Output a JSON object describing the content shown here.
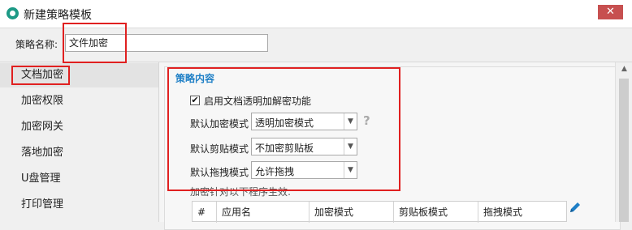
{
  "window": {
    "title": "新建策略模板",
    "close_label": "✕"
  },
  "name_row": {
    "label": "策略名称:",
    "value": "文件加密"
  },
  "sidebar": {
    "items": [
      {
        "label": "文档加密",
        "active": true
      },
      {
        "label": "加密权限"
      },
      {
        "label": "加密网关"
      },
      {
        "label": "落地加密"
      },
      {
        "label": "U盘管理"
      },
      {
        "label": "打印管理"
      }
    ]
  },
  "content": {
    "section_title": "策略内容",
    "enable_checkbox": {
      "checked": true,
      "mark": "✔",
      "label": "启用文档透明加解密功能"
    },
    "rows": [
      {
        "label": "默认加密模式",
        "value": "透明加密模式"
      },
      {
        "label": "默认剪贴模式",
        "value": "不加密剪贴板"
      },
      {
        "label": "默认拖拽模式",
        "value": "允许拖拽"
      }
    ],
    "help_glyph": "?",
    "dropdown_arrow": "▼",
    "hint": "加密针对以下程序生效:",
    "table_headers": [
      "#",
      "应用名",
      "加密模式",
      "剪贴板模式",
      "拖拽模式"
    ]
  },
  "icons": {
    "app": "app-logo-icon",
    "help": "question-icon",
    "edit": "pencil-icon",
    "scroll_up": "▲"
  },
  "colors": {
    "accent": "#1e7fc6",
    "highlight": "#e02020",
    "close": "#c75050",
    "app_icon": "#1d9a86"
  }
}
